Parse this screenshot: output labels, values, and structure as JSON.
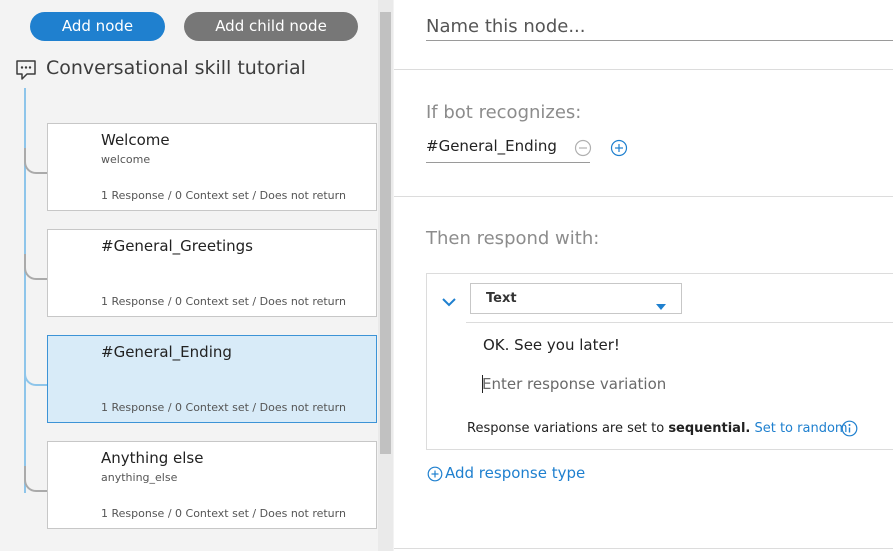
{
  "toolbar": {
    "add_node_label": "Add node",
    "add_child_node_label": "Add child node"
  },
  "tree": {
    "root_label": "Conversational skill tutorial",
    "nodes": [
      {
        "title": "Welcome",
        "condition": "welcome",
        "meta": "1 Response / 0 Context set / Does not return",
        "selected": false
      },
      {
        "title": "#General_Greetings",
        "condition": "",
        "meta": "1 Response / 0 Context set / Does not return",
        "selected": false
      },
      {
        "title": "#General_Ending",
        "condition": "",
        "meta": "1 Response / 0 Context set / Does not return",
        "selected": true
      },
      {
        "title": "Anything else",
        "condition": "anything_else",
        "meta": "1 Response / 0 Context set / Does not return",
        "selected": false
      }
    ]
  },
  "editor": {
    "name_placeholder": "Name this node...",
    "name_value": "",
    "if_label": "If bot recognizes:",
    "condition_value": "#General_Ending",
    "then_label": "Then respond with:",
    "response_type": "Text",
    "responses": [
      "OK. See you later!"
    ],
    "response_placeholder": "Enter response variation",
    "variation_prefix": "Response variations are set to",
    "variation_mode": "sequential.",
    "set_random_label": "Set to random",
    "add_response_type_label": "Add response type"
  },
  "icons": {
    "root": "chat-bubble-icon",
    "remove": "minus-circle-icon",
    "add": "plus-circle-icon",
    "collapse": "chevron-down-icon",
    "dropdown": "caret-down-icon",
    "info": "info-icon"
  },
  "colors": {
    "accent": "#1f80cf",
    "selected_bg": "#d8ebf8",
    "secondary_button": "#777777"
  }
}
